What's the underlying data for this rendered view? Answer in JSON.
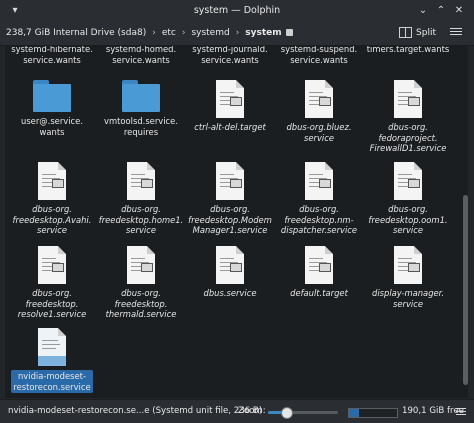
{
  "window": {
    "title": "system — Dolphin"
  },
  "breadcrumb": {
    "drive": "238,7 GiB Internal Drive (sda8)",
    "parts": [
      "etc",
      "systemd"
    ],
    "current": "system",
    "sep": "›"
  },
  "toolbar": {
    "split_label": "Split"
  },
  "files": [
    {
      "label": "systemd-hibernate.\nservice.wants",
      "type": "folder-partial",
      "italic": false
    },
    {
      "label": "systemd-homed.\nservice.wants",
      "type": "folder-partial",
      "italic": false
    },
    {
      "label": "systemd-journald.\nservice.wants",
      "type": "folder-partial",
      "italic": false
    },
    {
      "label": "systemd-suspend.\nservice.wants",
      "type": "folder-partial",
      "italic": false
    },
    {
      "label": "timers.target.wants",
      "type": "folder-partial",
      "italic": false
    },
    {
      "label": "user@.service.\nwants",
      "type": "folder",
      "italic": false
    },
    {
      "label": "vmtoolsd.service.\nrequires",
      "type": "folder",
      "italic": false
    },
    {
      "label": "ctrl-alt-del.target",
      "type": "doc",
      "italic": true
    },
    {
      "label": "dbus-org.bluez.\nservice",
      "type": "doc",
      "italic": true
    },
    {
      "label": "dbus-org.\nfedoraproject.\nFirewallD1.service",
      "type": "doc",
      "italic": true
    },
    {
      "label": "dbus-org.\nfreedesktop.Avahi.\nservice",
      "type": "doc",
      "italic": true
    },
    {
      "label": "dbus-org.\nfreedesktop.home1.\nservice",
      "type": "doc",
      "italic": true
    },
    {
      "label": "dbus-org.\nfreedesktop.Modem\nManager1.service",
      "type": "doc",
      "italic": true
    },
    {
      "label": "dbus-org.\nfreedesktop.nm-\ndispatcher.service",
      "type": "doc",
      "italic": true
    },
    {
      "label": "dbus-org.\nfreedesktop.oom1.\nservice",
      "type": "doc",
      "italic": true
    },
    {
      "label": "dbus-org.\nfreedesktop.\nresolve1.service",
      "type": "doc",
      "italic": true
    },
    {
      "label": "dbus-org.\nfreedesktop.\nthermald.service",
      "type": "doc",
      "italic": true
    },
    {
      "label": "dbus.service",
      "type": "doc",
      "italic": true
    },
    {
      "label": "default.target",
      "type": "doc",
      "italic": true
    },
    {
      "label": "display-manager.\nservice",
      "type": "doc",
      "italic": true
    },
    {
      "label": "nvidia-modeset-\nrestorecon.service",
      "type": "doc-blue",
      "italic": false,
      "selected": true
    }
  ],
  "status": {
    "text": "nvidia-modeset-restorecon.se...e (Systemd unit file, 236 B)",
    "zoom_label": "Zoom:",
    "zoom_level": 0.25,
    "free_text": "190,1 GiB free",
    "used_fraction": 0.2
  },
  "colors": {
    "accent": "#3b87c4",
    "selection": "#2b6aa8",
    "folder": "#4a9ad6"
  }
}
